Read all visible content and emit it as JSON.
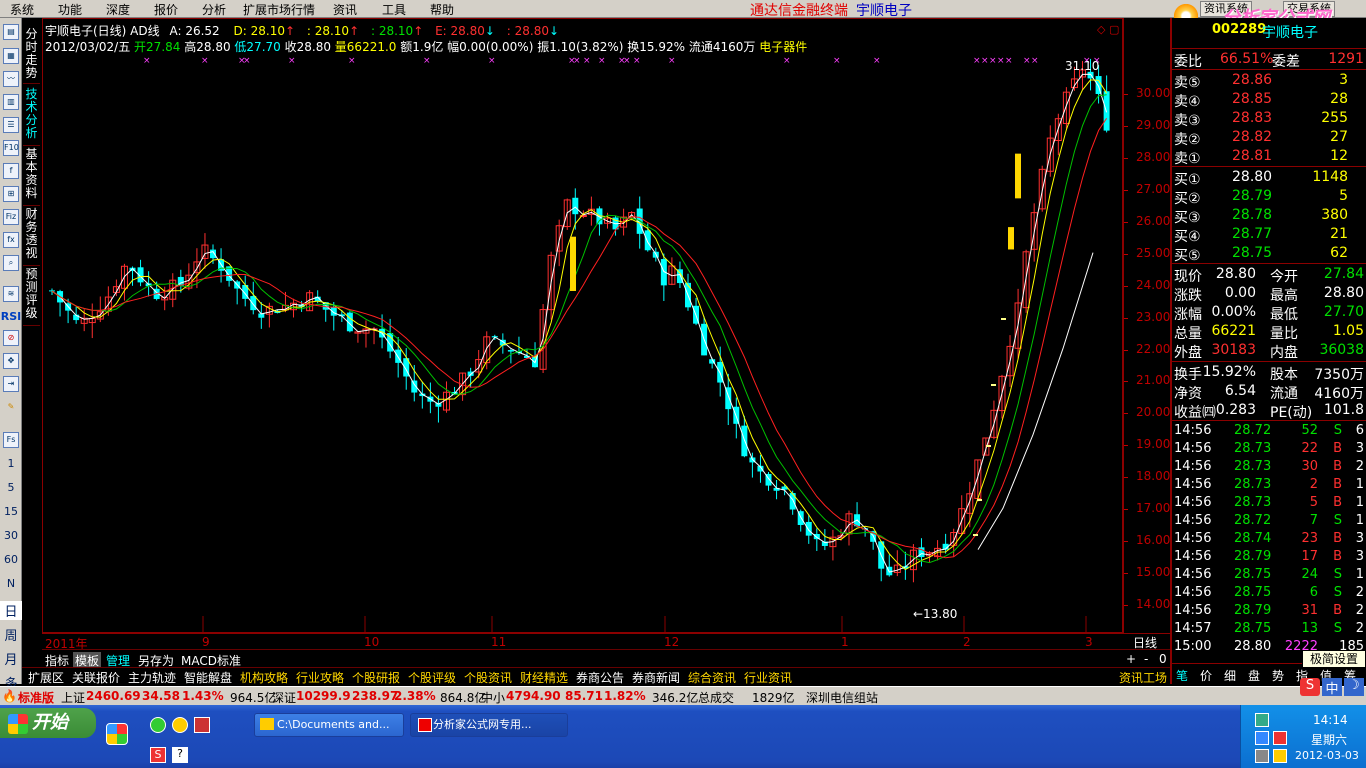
{
  "menubar": {
    "items": [
      "系统",
      "功能",
      "深度",
      "报价",
      "分析",
      "扩展市场行情",
      "资讯",
      "工具",
      "帮助"
    ],
    "brand": "通达信金融终端",
    "stock_name": "宇顺电子",
    "btn1": "资讯系统",
    "btn2": "交易系统",
    "watermark": "分析家公式网",
    "watermark_url": "www.88gs.com"
  },
  "vtabs": [
    "分时走势",
    "技术分析",
    "基本资料",
    "财务透视",
    "预测评级"
  ],
  "leftbar": {
    "icons": [
      "chart-icon",
      "grid-icon",
      "line-icon",
      "kline-icon",
      "list-icon",
      "F10",
      "f-icon",
      "book-icon",
      "FIZ",
      "f-icon2",
      "search-icon"
    ],
    "labels": [
      "RSI",
      "1",
      "5",
      "15",
      "30",
      "60",
      "N",
      "日",
      "周",
      "月",
      "多"
    ]
  },
  "chart": {
    "title": "宇顺电子(日线) AD线",
    "ind": {
      "a": "A: 26.52",
      "d": "D: 28.10",
      "v3": ": 28.10",
      "v4": ": 28.10",
      "e": "E: 28.80",
      "v6": ": 28.80"
    },
    "info": {
      "date": "2012/03/02/五",
      "open": "开27.84",
      "high": "高28.80",
      "low": "低27.70",
      "close": "收28.80",
      "vol": "量66221.0",
      "amt": "额1.9亿",
      "chg": "幅0.00(0.00%)",
      "amp": "振1.10(3.82%)",
      "turn": "换15.92%",
      "float": "流通4160万",
      "industry": "电子器件"
    },
    "max_label": "31.10",
    "min_label": "←13.80",
    "colors": {
      "up": "#ff3030",
      "down": "#00ffff",
      "ma1": "#ffffff",
      "ma2": "#ffff00",
      "ma3": "#00c000",
      "ma4": "#ff2020",
      "signal": "#ffd700",
      "xmark": "#ff40ff"
    }
  },
  "yaxis": [
    "30.00",
    "29.00",
    "28.00",
    "27.00",
    "26.00",
    "25.00",
    "24.00",
    "23.00",
    "22.00",
    "21.00",
    "20.00",
    "19.00",
    "18.00",
    "17.00",
    "16.00",
    "15.00",
    "14.00"
  ],
  "xaxis": [
    "2011年",
    "9",
    "10",
    "11",
    "12",
    "1",
    "2",
    "3"
  ],
  "xaxis_right": {
    "period": "日线",
    "plus": "+",
    "minus": "-",
    "zero": "0"
  },
  "tabs1": [
    "指标",
    "模板",
    "管理",
    "另存为",
    "MACD标准"
  ],
  "tabs2": [
    "扩展区",
    "关联报价",
    "主力轨迹",
    "智能解盘",
    "机构攻略",
    "行业攻略",
    "个股研报",
    "个股评级",
    "个股资讯",
    "财经精选",
    "券商公告",
    "券商新闻",
    "综合资讯",
    "行业资讯"
  ],
  "tabs2_right": "资讯工场",
  "rpanel": {
    "code": "002289",
    "name": "宇顺电子",
    "weibi_label": "委比",
    "weibi": "66.51%",
    "weicha_label": "委差",
    "weicha": "1291",
    "asks": [
      {
        "l": "卖⑤",
        "p": "28.86",
        "v": "3"
      },
      {
        "l": "卖④",
        "p": "28.85",
        "v": "28"
      },
      {
        "l": "卖③",
        "p": "28.83",
        "v": "255"
      },
      {
        "l": "卖②",
        "p": "28.82",
        "v": "27"
      },
      {
        "l": "卖①",
        "p": "28.81",
        "v": "12"
      }
    ],
    "bids": [
      {
        "l": "买①",
        "p": "28.80",
        "v": "1148"
      },
      {
        "l": "买②",
        "p": "28.79",
        "v": "5"
      },
      {
        "l": "买③",
        "p": "28.78",
        "v": "380"
      },
      {
        "l": "买④",
        "p": "28.77",
        "v": "21"
      },
      {
        "l": "买⑤",
        "p": "28.75",
        "v": "62"
      }
    ],
    "quote": [
      {
        "l1": "现价",
        "v1": "28.80",
        "l2": "今开",
        "v2": "27.84"
      },
      {
        "l1": "涨跌",
        "v1": "0.00",
        "l2": "最高",
        "v2": "28.80"
      },
      {
        "l1": "涨幅",
        "v1": "0.00%",
        "l2": "最低",
        "v2": "27.70"
      },
      {
        "l1": "总量",
        "v1": "66221",
        "l2": "量比",
        "v2": "1.05"
      },
      {
        "l1": "外盘",
        "v1": "30183",
        "l2": "内盘",
        "v2": "36038"
      }
    ],
    "fin": [
      {
        "l1": "换手",
        "v1": "15.92%",
        "l2": "股本",
        "v2": "7350万"
      },
      {
        "l1": "净资",
        "v1": "6.54",
        "l2": "流通",
        "v2": "4160万"
      },
      {
        "l1": "收益㈣",
        "v1": "0.283",
        "l2": "PE(动)",
        "v2": "101.8"
      }
    ],
    "ticks": [
      {
        "t": "14:56",
        "p": "28.72",
        "v": "52",
        "s": "S",
        "n": "6"
      },
      {
        "t": "14:56",
        "p": "28.73",
        "v": "22",
        "s": "B",
        "n": "3"
      },
      {
        "t": "14:56",
        "p": "28.73",
        "v": "30",
        "s": "B",
        "n": "2"
      },
      {
        "t": "14:56",
        "p": "28.73",
        "v": "2",
        "s": "B",
        "n": "1"
      },
      {
        "t": "14:56",
        "p": "28.73",
        "v": "5",
        "s": "B",
        "n": "1"
      },
      {
        "t": "14:56",
        "p": "28.72",
        "v": "7",
        "s": "S",
        "n": "1"
      },
      {
        "t": "14:56",
        "p": "28.74",
        "v": "23",
        "s": "B",
        "n": "3"
      },
      {
        "t": "14:56",
        "p": "28.79",
        "v": "17",
        "s": "B",
        "n": "3"
      },
      {
        "t": "14:56",
        "p": "28.75",
        "v": "24",
        "s": "S",
        "n": "1"
      },
      {
        "t": "14:56",
        "p": "28.75",
        "v": "6",
        "s": "S",
        "n": "2"
      },
      {
        "t": "14:56",
        "p": "28.79",
        "v": "31",
        "s": "B",
        "n": "2"
      },
      {
        "t": "14:57",
        "p": "28.75",
        "v": "13",
        "s": "S",
        "n": "2"
      },
      {
        "t": "15:00",
        "p": "28.80",
        "v": "2222",
        "s": "",
        "n": "185"
      }
    ],
    "bottom_tabs": [
      "笔",
      "价",
      "细",
      "盘",
      "势",
      "指",
      "值",
      "筹"
    ],
    "tooltip": "极简设置"
  },
  "status": {
    "edition": "标准版",
    "sh_label": "上证",
    "sh": "2460.69",
    "sh_chg": "34.58",
    "sh_pct": "1.43%",
    "sh_amt": "964.5亿",
    "sz_label": "深证",
    "sz": "10299.9",
    "sz_chg": "238.97",
    "sz_pct": "2.38%",
    "sz_amt": "864.8亿",
    "zx_label": "中小",
    "zx": "4794.90",
    "zx_chg": "85.71",
    "zx_pct": "1.82%",
    "zx_amt": "346.2亿",
    "total_label": "总成交",
    "total": "1829亿",
    "server": "深圳电信组站"
  },
  "taskbar": {
    "start": "开始",
    "app1": "C:\\Documents and...",
    "app2": "分析家公式网专用...",
    "time": "14:14",
    "day": "星期六",
    "date": "2012-03-03"
  }
}
